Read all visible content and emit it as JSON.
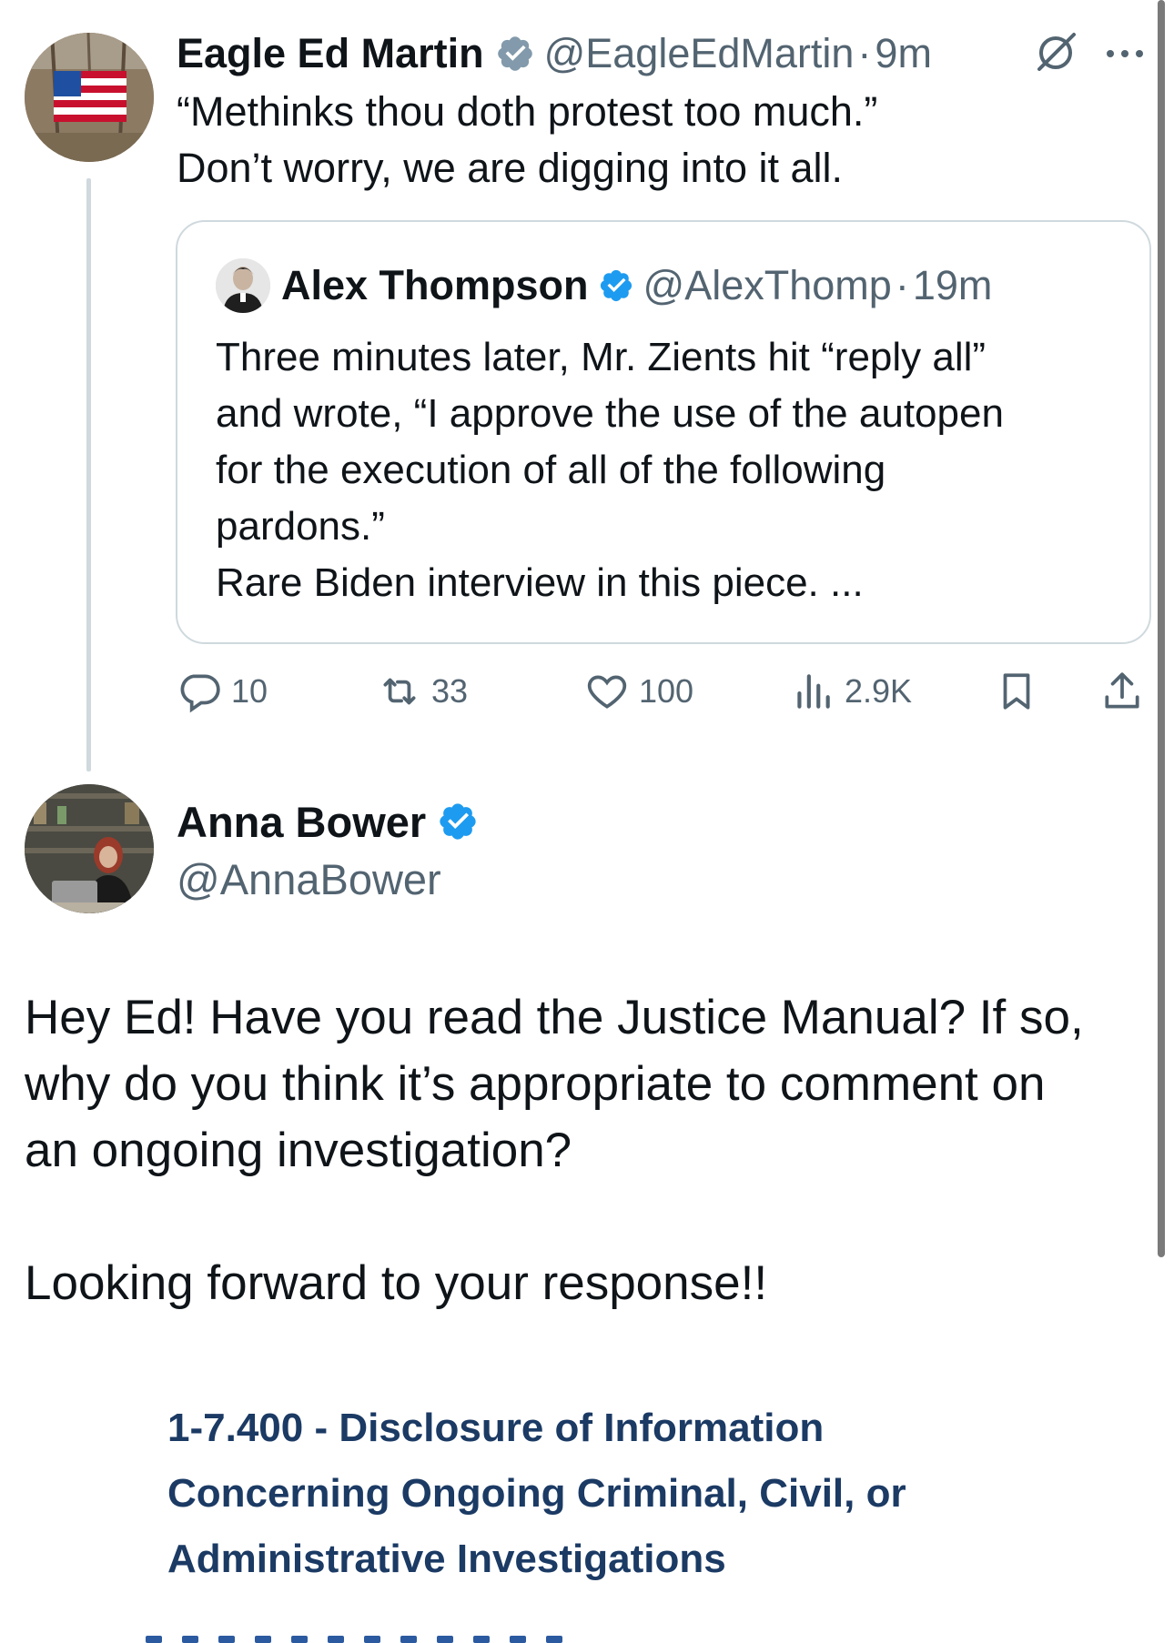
{
  "tweet1": {
    "name": "Eagle Ed Martin",
    "handle": "@EagleEdMartin",
    "separator": "·",
    "time": "9m",
    "text_line1": "“Methinks thou doth protest too much.”",
    "text_line2": "Don’t worry, we are digging into it all.",
    "badge_color": "#829aab",
    "icons": {
      "grok": "grok-icon",
      "more": "more-icon"
    }
  },
  "quote": {
    "name": "Alex Thompson",
    "handle": "@AlexThomp",
    "separator": "·",
    "time": "19m",
    "text_line1": "Three minutes later, Mr. Zients hit “reply all”",
    "text_line2": "and wrote, “I approve the use of the autopen",
    "text_line3": "for the execution of all of the following",
    "text_line4": "pardons.”",
    "text_line5": "Rare Biden interview in this piece. ...",
    "badge_color": "#1d9bf0"
  },
  "actions": {
    "replies": "10",
    "reposts": "33",
    "likes": "100",
    "views": "2.9K"
  },
  "tweet2": {
    "name": "Anna Bower",
    "handle": "@AnnaBower",
    "badge_color": "#1d9bf0",
    "paragraph1_line1": "Hey Ed! Have you read the Justice Manual? If so,",
    "paragraph1_line2": "why do you think it’s appropriate to comment on",
    "paragraph1_line3": "an ongoing investigation?",
    "paragraph2": "Looking forward to your response!!"
  },
  "attachment": {
    "heading_line1": "1-7.400 - Disclosure of Information",
    "heading_line2": "Concerning Ongoing Criminal, Civil, or",
    "heading_line3": "Administrative Investigations",
    "heading_color": "#1b3a64"
  }
}
